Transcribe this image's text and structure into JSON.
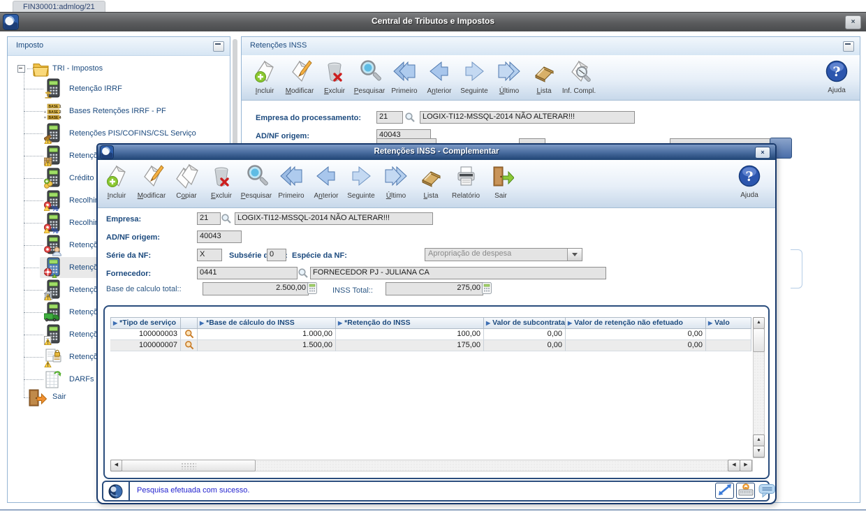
{
  "tab": {
    "title": "FIN30001:admlog/21"
  },
  "window": {
    "title": "Central de Tributos e Impostos",
    "close_glyph": "×"
  },
  "sidebar": {
    "title": "Imposto",
    "tree": {
      "root": "TRI - Impostos",
      "items": [
        {
          "label": "Retenção IRRF",
          "icon": "calc-scales"
        },
        {
          "label": "Bases Retenções IRRF - PF",
          "icon": "bases"
        },
        {
          "label": "Retenções PIS/COFINS/CSL Serviço",
          "icon": "calc-gavel"
        },
        {
          "label": "Retençõ",
          "icon": "calc-box"
        },
        {
          "label": "Crédito P",
          "icon": "calc-coins"
        },
        {
          "label": "Recolhim",
          "icon": "calc-percent"
        },
        {
          "label": "Recolhim",
          "icon": "calc-percent"
        },
        {
          "label": "Retençõ",
          "icon": "calc-person"
        },
        {
          "label": "Retençõ",
          "icon": "calc-lifering",
          "selected": true
        },
        {
          "label": "Retençõ",
          "icon": "calc-bank"
        },
        {
          "label": "Retençõ",
          "icon": "calc-truck"
        },
        {
          "label": "Retençõ",
          "icon": "calc-doc"
        },
        {
          "label": "Retençõ",
          "icon": "doc-lock"
        },
        {
          "label": "DARFs E",
          "icon": "sheet-arrow"
        }
      ],
      "exit": {
        "label": "Sair",
        "icon": "door"
      }
    }
  },
  "main": {
    "title": "Retenções INSS",
    "toolbar": [
      {
        "label": "Incluir",
        "icon": "paper-plus",
        "u": 0
      },
      {
        "label": "Modificar",
        "icon": "paper-pencil",
        "u": 0
      },
      {
        "label": "Excluir",
        "icon": "trash",
        "u": 0
      },
      {
        "label": "Pesquisar",
        "icon": "magnifier",
        "u": 0
      },
      {
        "label": "Primeiro",
        "icon": "arrow-first",
        "u": -1
      },
      {
        "label": "Anterior",
        "icon": "arrow-prev",
        "u": 1
      },
      {
        "label": "Seguinte",
        "icon": "arrow-next",
        "u": 2
      },
      {
        "label": "Último",
        "icon": "arrow-last",
        "u": 0
      },
      {
        "label": "Lista",
        "icon": "book",
        "u": 0
      },
      {
        "label": "Inf. Compl.",
        "icon": "paper-magnifier",
        "u": -1
      }
    ],
    "help_label": "Ajuda",
    "fields": {
      "empresa_label": "Empresa do processamento:",
      "empresa_code": "21",
      "empresa_desc": "LOGIX-TI12-MSSQL-2014 NÃO ALTERAR!!!",
      "adnf_label": "AD/NF origem:",
      "adnf_value": "40043"
    }
  },
  "modal": {
    "title": "Retenções INSS - Complementar",
    "close_glyph": "×",
    "toolbar": [
      {
        "label": "Incluir",
        "icon": "paper-plus",
        "u": 0
      },
      {
        "label": "Modificar",
        "icon": "paper-pencil",
        "u": 0
      },
      {
        "label": "Copiar",
        "icon": "papers",
        "u": 1
      },
      {
        "label": "Excluir",
        "icon": "trash",
        "u": 0
      },
      {
        "label": "Pesquisar",
        "icon": "magnifier",
        "u": 0
      },
      {
        "label": "Primeiro",
        "icon": "arrow-first",
        "u": -1
      },
      {
        "label": "Anterior",
        "icon": "arrow-prev",
        "u": 1
      },
      {
        "label": "Seguinte",
        "icon": "arrow-next",
        "u": 2
      },
      {
        "label": "Último",
        "icon": "arrow-last",
        "u": 0
      },
      {
        "label": "Lista",
        "icon": "book",
        "u": 0
      },
      {
        "label": "Relatório",
        "icon": "printer",
        "u": -1
      },
      {
        "label": "Sair",
        "icon": "door-exit",
        "u": -1
      }
    ],
    "help_label": "Ajuda",
    "fields": {
      "empresa_label": "Empresa:",
      "empresa_code": "21",
      "empresa_desc": "LOGIX-TI12-MSSQL-2014 NÃO ALTERAR!!!",
      "adnf_label": "AD/NF origem:",
      "adnf_value": "40043",
      "serie_label": "Série da NF:",
      "serie_value": "X",
      "subserie_label": "Subsérie da NF:",
      "subserie_value": "0",
      "especie_label": "Espécie da NF:",
      "especie_value": "Apropriação de despesa",
      "fornecedor_label": "Fornecedor:",
      "fornecedor_code": "0441",
      "fornecedor_desc": "FORNECEDOR PJ - JULIANA CA",
      "base_label": "Base de calculo total::",
      "base_value": "2.500,00",
      "inss_label": "INSS Total::",
      "inss_value": "275,00"
    },
    "table": {
      "columns": [
        "*Tipo de serviço",
        "",
        "*Base de cálculo do INSS",
        "*Retenção do INSS",
        "Valor de subcontratação",
        "Valor de retenção não efetuado",
        "Valo"
      ],
      "rows": [
        {
          "tipo": "100000003",
          "base": "1.000,00",
          "retencao": "100,00",
          "subcontratacao": "0,00",
          "nao_efetuado": "0,00",
          "extra": ""
        },
        {
          "tipo": "100000007",
          "base": "1.500,00",
          "retencao": "175,00",
          "subcontratacao": "0,00",
          "nao_efetuado": "0,00",
          "extra": ""
        }
      ]
    },
    "status": {
      "message": "Pesquisa efetuada com sucesso."
    }
  },
  "colors": {
    "accent_navy": "#1c4a7e",
    "modal_border": "#17386b",
    "status_text": "#2323cf",
    "field_bg": "#e4e4e4",
    "selected_bg": "#e9e9e9"
  }
}
